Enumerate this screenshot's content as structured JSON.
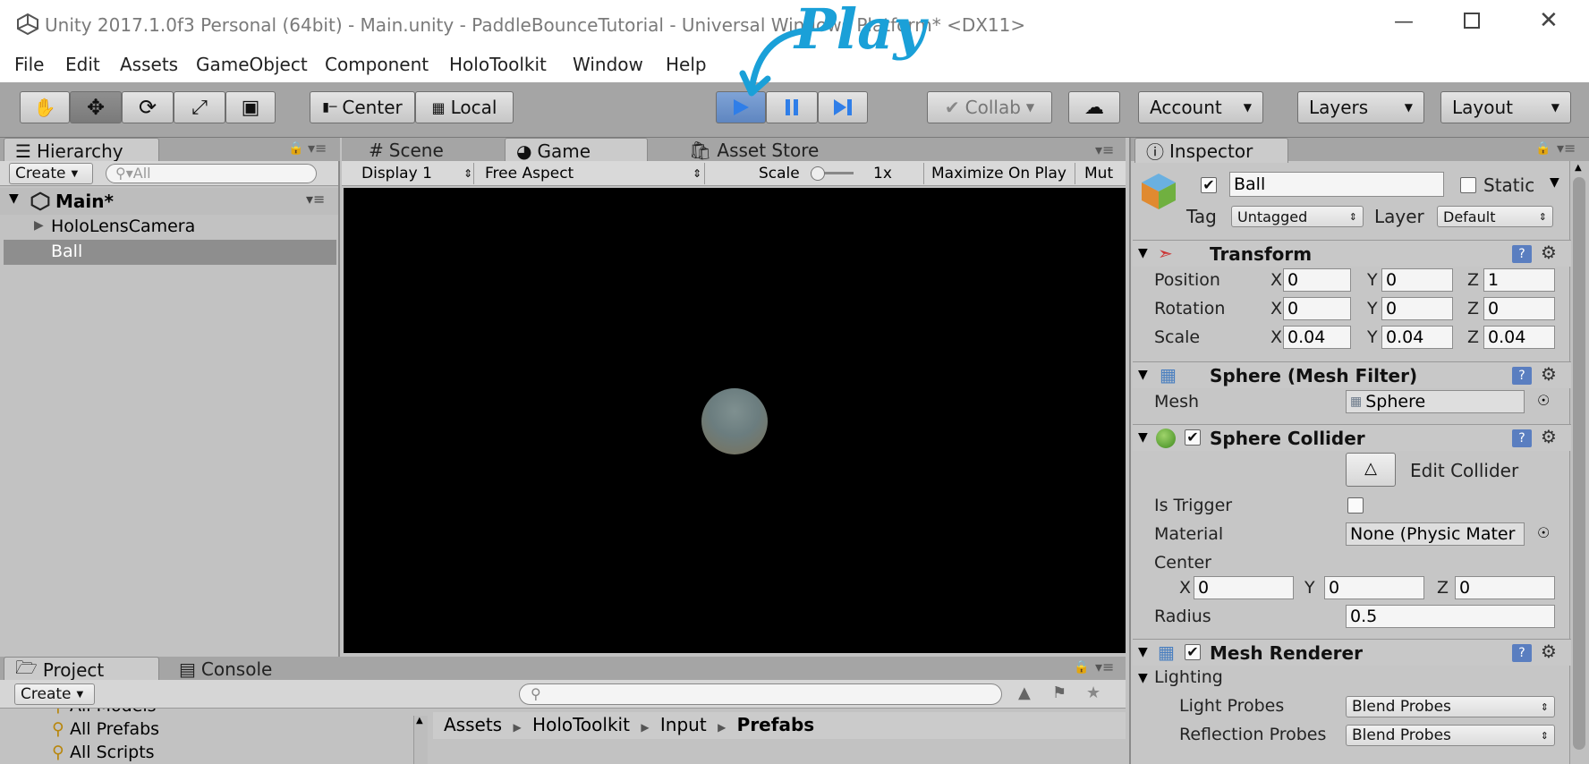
{
  "window": {
    "title": "Unity 2017.1.0f3 Personal (64bit) - Main.unity - PaddleBounceTutorial - Universal Windows Platform* <DX11>"
  },
  "annotation": {
    "text": "Play"
  },
  "menu": [
    "File",
    "Edit",
    "Assets",
    "GameObject",
    "Component",
    "HoloToolkit",
    "Window",
    "Help"
  ],
  "toolbar": {
    "pivot": "Center",
    "space": "Local",
    "collab": "Collab",
    "account": "Account",
    "layers": "Layers",
    "layout": "Layout"
  },
  "hierarchy": {
    "tab": "Hierarchy",
    "create": "Create",
    "search_placeholder": "All",
    "scene": "Main*",
    "items": [
      "HoloLensCamera",
      "Ball"
    ]
  },
  "center_tabs": {
    "scene": "Scene",
    "game": "Game",
    "asset_store": "Asset Store"
  },
  "game_bar": {
    "display": "Display 1",
    "aspect": "Free Aspect",
    "scale_label": "Scale",
    "scale_value": "1x",
    "maximize": "Maximize On Play",
    "mute": "Mut"
  },
  "project": {
    "tab_project": "Project",
    "tab_console": "Console",
    "create": "Create",
    "favorites": [
      "All Models",
      "All Prefabs",
      "All Scripts"
    ],
    "breadcrumb": [
      "Assets",
      "HoloToolkit",
      "Input",
      "Prefabs"
    ]
  },
  "inspector": {
    "tab": "Inspector",
    "object_name": "Ball",
    "static_label": "Static",
    "tag_label": "Tag",
    "tag_value": "Untagged",
    "layer_label": "Layer",
    "layer_value": "Default",
    "transform": {
      "title": "Transform",
      "position": {
        "label": "Position",
        "x": "0",
        "y": "0",
        "z": "1"
      },
      "rotation": {
        "label": "Rotation",
        "x": "0",
        "y": "0",
        "z": "0"
      },
      "scale": {
        "label": "Scale",
        "x": "0.04",
        "y": "0.04",
        "z": "0.04"
      }
    },
    "mesh_filter": {
      "title": "Sphere (Mesh Filter)",
      "mesh_label": "Mesh",
      "mesh_value": "Sphere"
    },
    "collider": {
      "title": "Sphere Collider",
      "edit": "Edit Collider",
      "is_trigger": "Is Trigger",
      "material_label": "Material",
      "material_value": "None (Physic Mater",
      "center_label": "Center",
      "cx": "0",
      "cy": "0",
      "cz": "0",
      "radius_label": "Radius",
      "radius_value": "0.5"
    },
    "renderer": {
      "title": "Mesh Renderer",
      "lighting": "Lighting",
      "light_probes_label": "Light Probes",
      "light_probes_value": "Blend Probes",
      "reflection_probes_label": "Reflection Probes",
      "reflection_probes_value": "Blend Probes"
    }
  },
  "axis": {
    "x": "X",
    "y": "Y",
    "z": "Z"
  }
}
